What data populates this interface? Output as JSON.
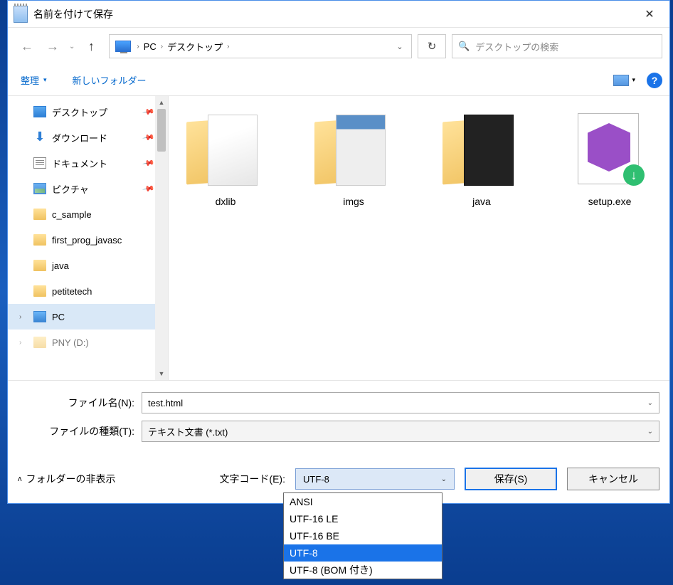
{
  "title": "名前を付けて保存",
  "breadcrumb": {
    "root": "PC",
    "folder": "デスクトップ"
  },
  "search": {
    "placeholder": "デスクトップの検索"
  },
  "toolbar": {
    "organize": "整理",
    "newfolder": "新しいフォルダー"
  },
  "sidebar": {
    "items": [
      {
        "label": "デスクトップ",
        "icon": "desktop",
        "pinned": true
      },
      {
        "label": "ダウンロード",
        "icon": "download",
        "pinned": true
      },
      {
        "label": "ドキュメント",
        "icon": "doc",
        "pinned": true
      },
      {
        "label": "ピクチャ",
        "icon": "pic",
        "pinned": true
      },
      {
        "label": "c_sample",
        "icon": "folder"
      },
      {
        "label": "first_prog_javasc",
        "icon": "folder"
      },
      {
        "label": "java",
        "icon": "folder"
      },
      {
        "label": "petitetech",
        "icon": "folder"
      },
      {
        "label": "PC",
        "icon": "pc",
        "selected": true,
        "expand": true
      },
      {
        "label": "PNY (D:)",
        "icon": "drive",
        "expand": true,
        "faded": true
      }
    ]
  },
  "files": [
    {
      "name": "dxlib",
      "type": "folder-doc"
    },
    {
      "name": "imgs",
      "type": "folder-img"
    },
    {
      "name": "java",
      "type": "folder-dark"
    },
    {
      "name": "setup.exe",
      "type": "exe"
    }
  ],
  "form": {
    "filename_label": "ファイル名(N):",
    "filename_value": "test.html",
    "filetype_label": "ファイルの種類(T):",
    "filetype_value": "テキスト文書 (*.txt)",
    "encoding_label": "文字コード(E):",
    "encoding_value": "UTF-8",
    "encoding_options": [
      "ANSI",
      "UTF-16 LE",
      "UTF-16 BE",
      "UTF-8",
      "UTF-8 (BOM 付き)"
    ],
    "save": "保存(S)",
    "cancel": "キャンセル",
    "hide_folders": "フォルダーの非表示"
  }
}
